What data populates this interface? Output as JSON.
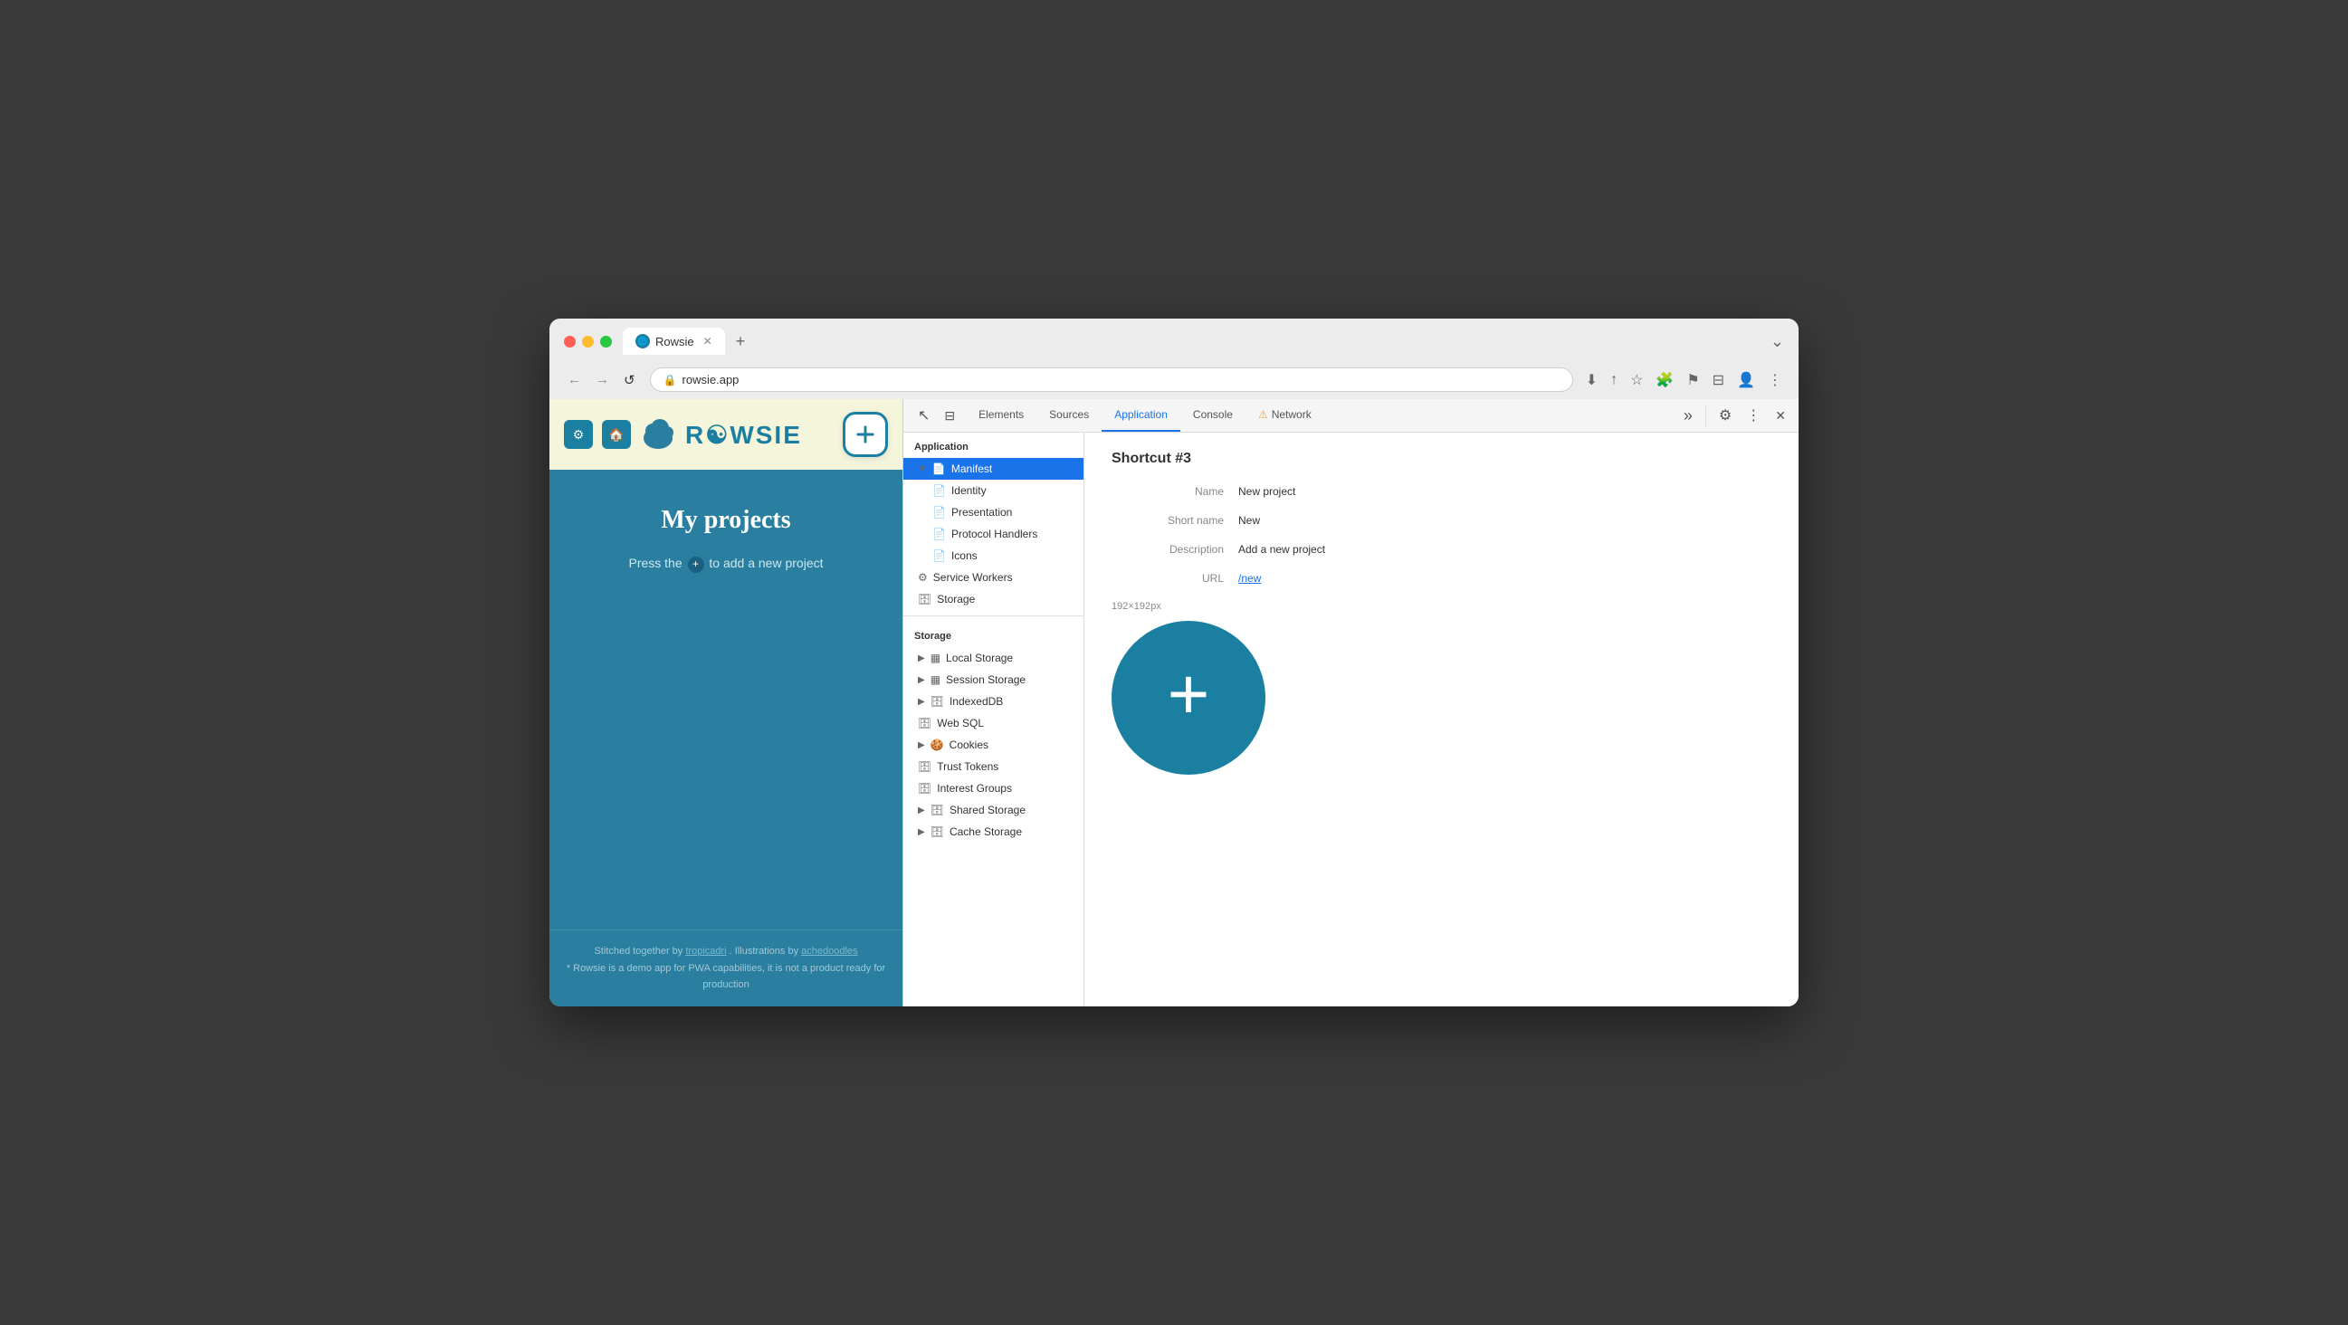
{
  "browser": {
    "tab_title": "Rowsie",
    "tab_favicon_emoji": "🌐",
    "address": "rowsie.app",
    "overflow_symbol": "⌄"
  },
  "nav": {
    "back": "←",
    "forward": "→",
    "refresh": "↺",
    "download": "⬇",
    "share": "↑",
    "star": "☆",
    "extension": "🧩",
    "flag": "⚑",
    "tablet": "⊟",
    "person": "👤",
    "more": "⋮"
  },
  "site": {
    "title": "My projects",
    "description_prefix": "Press the",
    "description_suffix": "to add a new project",
    "footer_line1": "Stitched together by",
    "footer_link1": "tropicadri",
    "footer_middle": ". Illustrations by",
    "footer_link2": "achedoodles",
    "footer_line2": "* Rowsie is a demo app for PWA capabilities, it is not a product ready for production"
  },
  "devtools": {
    "tabs": [
      {
        "id": "elements",
        "label": "Elements",
        "active": false
      },
      {
        "id": "sources",
        "label": "Sources",
        "active": false
      },
      {
        "id": "application",
        "label": "Application",
        "active": true
      },
      {
        "id": "console",
        "label": "Console",
        "active": false
      },
      {
        "id": "network",
        "label": "Network",
        "active": false,
        "warning": true
      }
    ],
    "more_label": "»",
    "settings_icon": "⚙",
    "more_icon": "⋮",
    "close_icon": "✕"
  },
  "sidebar": {
    "application_label": "Application",
    "items_app": [
      {
        "id": "manifest",
        "label": "Manifest",
        "icon": "📄",
        "active": true,
        "has_chevron": true,
        "expanded": true
      },
      {
        "id": "identity",
        "label": "Identity",
        "icon": "📄",
        "indented": true
      },
      {
        "id": "presentation",
        "label": "Presentation",
        "icon": "📄",
        "indented": true
      },
      {
        "id": "protocol-handlers",
        "label": "Protocol Handlers",
        "icon": "📄",
        "indented": true
      },
      {
        "id": "icons",
        "label": "Icons",
        "icon": "📄",
        "indented": true
      },
      {
        "id": "service-workers",
        "label": "Service Workers",
        "icon": "⚙",
        "indented": false
      },
      {
        "id": "storage",
        "label": "Storage",
        "icon": "🗄",
        "indented": false
      }
    ],
    "storage_label": "Storage",
    "items_storage": [
      {
        "id": "local-storage",
        "label": "Local Storage",
        "icon": "▦",
        "has_chevron": true
      },
      {
        "id": "session-storage",
        "label": "Session Storage",
        "icon": "▦",
        "has_chevron": true
      },
      {
        "id": "indexed-db",
        "label": "IndexedDB",
        "icon": "🗄",
        "has_chevron": true
      },
      {
        "id": "web-sql",
        "label": "Web SQL",
        "icon": "🗄"
      },
      {
        "id": "cookies",
        "label": "Cookies",
        "icon": "🍪",
        "has_chevron": true
      },
      {
        "id": "trust-tokens",
        "label": "Trust Tokens",
        "icon": "🗄"
      },
      {
        "id": "interest-groups",
        "label": "Interest Groups",
        "icon": "🗄"
      },
      {
        "id": "shared-storage",
        "label": "Shared Storage",
        "icon": "🗄",
        "has_chevron": true
      },
      {
        "id": "cache-storage",
        "label": "Cache Storage",
        "icon": "🗄",
        "has_chevron": true
      }
    ]
  },
  "panel": {
    "shortcut_title": "Shortcut #3",
    "fields": [
      {
        "label": "Name",
        "value": "New project",
        "is_link": false
      },
      {
        "label": "Short name",
        "value": "New",
        "is_link": false
      },
      {
        "label": "Description",
        "value": "Add a new project",
        "is_link": false
      },
      {
        "label": "URL",
        "value": "/new",
        "is_link": true
      }
    ],
    "icon_size_label": "192×192px",
    "icon_plus": "+"
  }
}
